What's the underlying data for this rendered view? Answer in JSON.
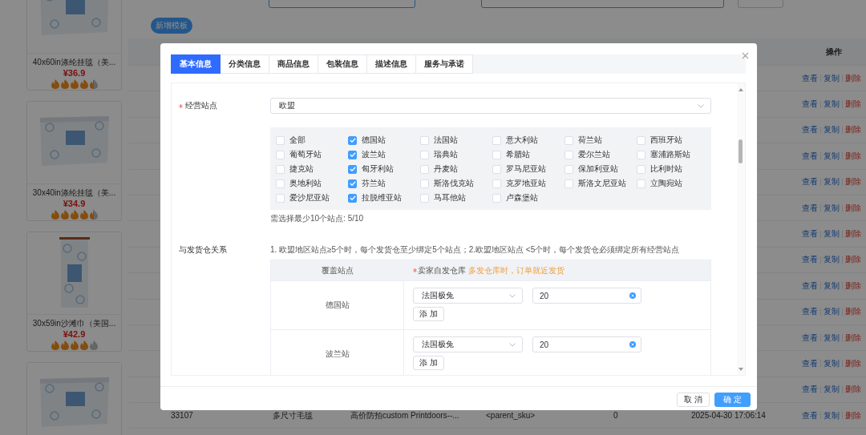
{
  "page": {
    "add_button": "新增模板",
    "products": [
      {
        "title": "40x60in涤纶挂毯（美...",
        "price": "¥36.9",
        "stars": 4.5
      },
      {
        "title": "30x40in涤纶挂毯（美...",
        "price": "¥34.9",
        "stars": 4.5
      },
      {
        "title": "30x59in沙滩巾（美国...",
        "price": "¥42.9",
        "stars": 4
      },
      {
        "kind": "picture"
      }
    ],
    "table": {
      "columns": [
        "操作"
      ],
      "rows": [
        {
          "actions": [
            {
              "label": "查看",
              "kind": "link"
            },
            {
              "label": "复制",
              "kind": "link"
            },
            {
              "label": "删除",
              "kind": "danger"
            }
          ]
        },
        {
          "actions": [
            {
              "label": "查看",
              "kind": "link"
            },
            {
              "label": "复制",
              "kind": "link"
            },
            {
              "label": "删除",
              "kind": "danger"
            }
          ]
        },
        {
          "actions": [
            {
              "label": "查看",
              "kind": "link"
            },
            {
              "label": "复制",
              "kind": "link"
            },
            {
              "label": "删除",
              "kind": "danger"
            }
          ]
        },
        {
          "actions": [
            {
              "label": "查看",
              "kind": "link"
            },
            {
              "label": "复制",
              "kind": "link"
            },
            {
              "label": "删除",
              "kind": "danger"
            }
          ]
        },
        {
          "actions": [
            {
              "label": "查看",
              "kind": "link"
            },
            {
              "label": "复制",
              "kind": "link"
            },
            {
              "label": "删除",
              "kind": "danger"
            }
          ]
        },
        {
          "actions": [
            {
              "label": "查看",
              "kind": "link"
            },
            {
              "label": "复制",
              "kind": "link"
            },
            {
              "label": "删除",
              "kind": "danger"
            }
          ]
        },
        {
          "actions": [
            {
              "label": "查看",
              "kind": "link"
            },
            {
              "label": "复制",
              "kind": "link"
            },
            {
              "label": "删除",
              "kind": "danger"
            }
          ]
        },
        {
          "actions": [
            {
              "label": "查看",
              "kind": "link"
            },
            {
              "label": "复制",
              "kind": "link"
            },
            {
              "label": "删除",
              "kind": "danger"
            }
          ]
        },
        {
          "actions": [
            {
              "label": "查看",
              "kind": "link"
            },
            {
              "label": "复制",
              "kind": "link"
            },
            {
              "label": "删除",
              "kind": "danger"
            }
          ]
        },
        {
          "actions": [
            {
              "label": "查看",
              "kind": "link"
            },
            {
              "label": "复制",
              "kind": "link"
            },
            {
              "label": "删除",
              "kind": "danger"
            }
          ]
        },
        {
          "actions": [
            {
              "label": "查看",
              "kind": "link"
            },
            {
              "label": "复制",
              "kind": "link"
            },
            {
              "label": "删除",
              "kind": "danger"
            }
          ]
        },
        {
          "actions": [
            {
              "label": "查看",
              "kind": "link"
            },
            {
              "label": "复制",
              "kind": "link"
            },
            {
              "label": "删除",
              "kind": "danger"
            }
          ]
        },
        {
          "actions": [
            {
              "label": "查看",
              "kind": "link"
            },
            {
              "label": "复制",
              "kind": "link"
            },
            {
              "label": "删除",
              "kind": "danger"
            }
          ]
        },
        {
          "cells": [
            "33107",
            "多尺寸毛毯",
            "高价防拍custom Printdoors--...",
            "<parent_sku>",
            "0",
            "2025-04-30 17:06:14"
          ],
          "actions": [
            {
              "label": "查看",
              "kind": "link"
            },
            {
              "label": "复制",
              "kind": "link"
            },
            {
              "label": "删除",
              "kind": "danger"
            }
          ]
        }
      ]
    }
  },
  "dialog": {
    "tabs": [
      {
        "label": "基本信息",
        "selected": true
      },
      {
        "label": "分类信息",
        "selected": false
      },
      {
        "label": "商品信息",
        "selected": false
      },
      {
        "label": "包装信息",
        "selected": false
      },
      {
        "label": "描述信息",
        "selected": false
      },
      {
        "label": "服务与承诺",
        "selected": false
      }
    ],
    "site_field": {
      "label": "经营站点",
      "required": true,
      "value": "欧盟"
    },
    "sites": [
      {
        "label": "全部",
        "checked": false
      },
      {
        "label": "德国站",
        "checked": true
      },
      {
        "label": "法国站",
        "checked": false
      },
      {
        "label": "意大利站",
        "checked": false
      },
      {
        "label": "荷兰站",
        "checked": false
      },
      {
        "label": "西班牙站",
        "checked": false
      },
      {
        "label": "葡萄牙站",
        "checked": false
      },
      {
        "label": "波兰站",
        "checked": true
      },
      {
        "label": "瑞典站",
        "checked": false
      },
      {
        "label": "希腊站",
        "checked": false
      },
      {
        "label": "爱尔兰站",
        "checked": false
      },
      {
        "label": "塞浦路斯站",
        "checked": false
      },
      {
        "label": "捷克站",
        "checked": false
      },
      {
        "label": "匈牙利站",
        "checked": true
      },
      {
        "label": "丹麦站",
        "checked": false
      },
      {
        "label": "罗马尼亚站",
        "checked": false
      },
      {
        "label": "保加利亚站",
        "checked": false
      },
      {
        "label": "比利时站",
        "checked": false
      },
      {
        "label": "奥地利站",
        "checked": false
      },
      {
        "label": "芬兰站",
        "checked": true
      },
      {
        "label": "斯洛伐克站",
        "checked": false
      },
      {
        "label": "克罗地亚站",
        "checked": false
      },
      {
        "label": "斯洛文尼亚站",
        "checked": false
      },
      {
        "label": "立陶宛站",
        "checked": false
      },
      {
        "label": "爱沙尼亚站",
        "checked": false
      },
      {
        "label": "拉脱维亚站",
        "checked": true
      },
      {
        "label": "马耳他站",
        "checked": false
      },
      {
        "label": "卢森堡站",
        "checked": false
      }
    ],
    "sites_hint": "需选择最少10个站点: 5/10",
    "relation": {
      "label": "与发货仓关系",
      "note": "1. 欧盟地区站点≥5个时，每个发货仓至少绑定5个站点；2.欧盟地区站点 <5个时，每个发货仓必须绑定所有经营站点",
      "columns": [
        {
          "label": "覆盖站点",
          "required": false
        },
        {
          "label": "卖家自发仓库",
          "required": true,
          "note": "多发仓库时，订单就近发货"
        }
      ],
      "rows": [
        {
          "station": "德国站",
          "warehouse": "法国极兔",
          "quantity": "20",
          "add_button": "添 加"
        },
        {
          "station": "波兰站",
          "warehouse": "法国极兔",
          "quantity": "20",
          "add_button": "添 加"
        }
      ]
    },
    "buttons": [
      {
        "label": "取 消",
        "kind": "default"
      },
      {
        "label": "确 定",
        "kind": "primary"
      }
    ]
  }
}
